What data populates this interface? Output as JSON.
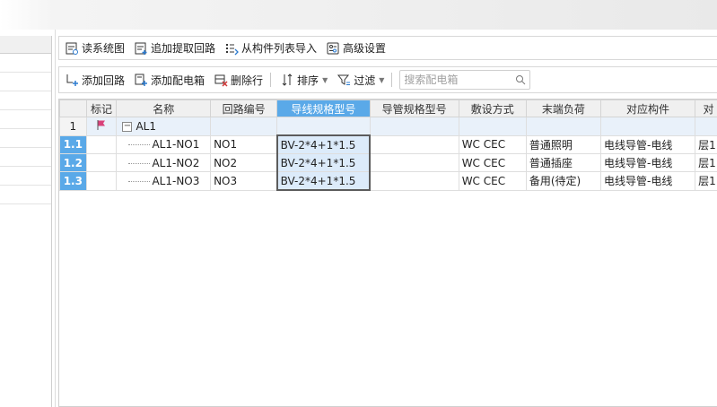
{
  "toolbar1": {
    "read_diagram": "读系统图",
    "append_extract": "追加提取回路",
    "import_from_list": "从构件列表导入",
    "advanced_settings": "高级设置"
  },
  "toolbar2": {
    "add_circuit": "添加回路",
    "add_distribution_box": "添加配电箱",
    "delete_row": "删除行",
    "sort": "排序",
    "filter": "过滤",
    "search_placeholder": "搜索配电箱"
  },
  "table": {
    "headers": [
      "",
      "标记",
      "名称",
      "回路编号",
      "导线规格型号",
      "导管规格型号",
      "敷设方式",
      "末端负荷",
      "对应构件",
      "对"
    ],
    "group": {
      "row": "1",
      "name": "AL1",
      "collapse_symbol": "−"
    },
    "rows": [
      {
        "row": "1.1",
        "name": "AL1-NO1",
        "circuit": "NO1",
        "wire_spec": "BV-2*4+1*1.5",
        "conduit_spec": "",
        "laying": "WC CEC",
        "load": "普通照明",
        "component": "电线导管-电线",
        "extra": "层1"
      },
      {
        "row": "1.2",
        "name": "AL1-NO2",
        "circuit": "NO2",
        "wire_spec": "BV-2*4+1*1.5",
        "conduit_spec": "",
        "laying": "WC CEC",
        "load": "普通插座",
        "component": "电线导管-电线",
        "extra": "层1"
      },
      {
        "row": "1.3",
        "name": "AL1-NO3",
        "circuit": "NO3",
        "wire_spec": "BV-2*4+1*1.5",
        "conduit_spec": "",
        "laying": "WC CEC",
        "load": "备用(待定)",
        "component": "电线导管-电线",
        "extra": "层1"
      }
    ]
  },
  "colors": {
    "accent": "#5aa9e8",
    "selected_cell": "#dcebfa",
    "group_row": "#e9f1fa",
    "flag": "#d9417a"
  }
}
